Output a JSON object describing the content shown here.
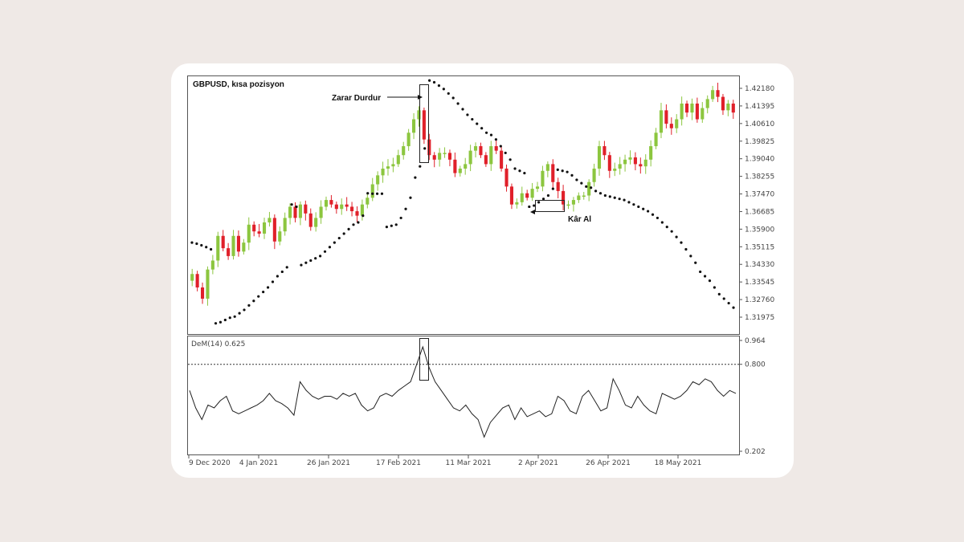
{
  "chart_data": [
    {
      "type": "candlestick",
      "title": "GBPUSD, kısa pozisyon",
      "x_tick_labels": [
        "9 Dec 2020",
        "4 Jan 2021",
        "26 Jan 2021",
        "17 Feb 2021",
        "11 Mar 2021",
        "2 Apr 2021",
        "26 Apr 2021",
        "18 May 2021"
      ],
      "y_tick_labels": [
        "1.42180",
        "1.41395",
        "1.40610",
        "1.39825",
        "1.39040",
        "1.38255",
        "1.37470",
        "1.36685",
        "1.35900",
        "1.35115",
        "1.34330",
        "1.33545",
        "1.32760",
        "1.31975"
      ],
      "ylim": [
        1.3163,
        1.4253
      ],
      "colors": {
        "up": "#8cc63f",
        "down": "#e0202a",
        "sar": "#111111"
      },
      "annotations": {
        "stop_loss": "Zarar Durdur",
        "take_profit": "Kâr Al"
      },
      "close": [
        1.339,
        1.333,
        1.328,
        1.341,
        1.345,
        1.356,
        1.3505,
        1.347,
        1.356,
        1.349,
        1.353,
        1.361,
        1.358,
        1.357,
        1.362,
        1.364,
        1.3535,
        1.358,
        1.364,
        1.369,
        1.364,
        1.37,
        1.366,
        1.36,
        1.364,
        1.369,
        1.372,
        1.37,
        1.368,
        1.37,
        1.369,
        1.367,
        1.365,
        1.37,
        1.373,
        1.379,
        1.383,
        1.386,
        1.387,
        1.388,
        1.392,
        1.396,
        1.402,
        1.408,
        1.412,
        1.399,
        1.392,
        1.39,
        1.393,
        1.393,
        1.39,
        1.384,
        1.386,
        1.388,
        1.394,
        1.396,
        1.392,
        1.388,
        1.396,
        1.394,
        1.386,
        1.378,
        1.37,
        1.371,
        1.375,
        1.373,
        1.377,
        1.378,
        1.385,
        1.388,
        1.38,
        1.376,
        1.37,
        1.37,
        1.372,
        1.374,
        1.374,
        1.38,
        1.386,
        1.396,
        1.392,
        1.385,
        1.386,
        1.388,
        1.39,
        1.391,
        1.388,
        1.387,
        1.39,
        1.396,
        1.402,
        1.412,
        1.406,
        1.404,
        1.408,
        1.415,
        1.411,
        1.415,
        1.408,
        1.413,
        1.417,
        1.421,
        1.418,
        1.412,
        1.415,
        1.411
      ],
      "sar_y": [
        1.353,
        1.3525,
        1.3518,
        1.351,
        1.35,
        1.317,
        1.3175,
        1.3185,
        1.3195,
        1.32,
        1.3215,
        1.323,
        1.325,
        1.327,
        1.329,
        1.331,
        1.333,
        1.3355,
        1.338,
        1.34,
        1.342,
        1.37,
        1.369,
        1.343,
        1.344,
        1.345,
        1.346,
        1.347,
        1.349,
        1.351,
        1.353,
        1.355,
        1.357,
        1.359,
        1.361,
        1.362,
        1.365,
        1.375,
        1.3748,
        1.3748,
        1.3748,
        1.36,
        1.3605,
        1.361,
        1.364,
        1.368,
        1.373,
        1.382,
        1.387,
        1.395,
        1.4253,
        1.4245,
        1.423,
        1.4215,
        1.4195,
        1.4175,
        1.415,
        1.4125,
        1.41,
        1.408,
        1.406,
        1.404,
        1.402,
        1.401,
        1.399,
        1.396,
        1.393,
        1.39,
        1.386,
        1.385,
        1.384,
        1.369,
        1.3695,
        1.371,
        1.3725,
        1.374,
        1.377,
        1.3855,
        1.385,
        1.3845,
        1.383,
        1.381,
        1.3795,
        1.378,
        1.3775,
        1.376,
        1.375,
        1.374,
        1.3735,
        1.373,
        1.3725,
        1.372,
        1.371,
        1.37,
        1.369,
        1.368,
        1.367,
        1.3655,
        1.364,
        1.362,
        1.36,
        1.358,
        1.3555,
        1.353,
        1.35,
        1.347,
        1.344,
        1.34,
        1.338,
        1.336,
        1.333,
        1.33,
        1.328,
        1.326,
        1.324
      ],
      "sar_pairs": [
        [
          0,
          1.353
        ],
        [
          1,
          1.3525
        ],
        [
          2,
          1.3518
        ],
        [
          3,
          1.351
        ],
        [
          4,
          1.35
        ],
        [
          5,
          1.317
        ],
        [
          6,
          1.3175
        ],
        [
          7,
          1.3185
        ],
        [
          8,
          1.3195
        ],
        [
          9,
          1.32
        ],
        [
          10,
          1.3215
        ],
        [
          11,
          1.323
        ],
        [
          12,
          1.325
        ],
        [
          13,
          1.327
        ],
        [
          14,
          1.329
        ],
        [
          15,
          1.331
        ],
        [
          16,
          1.333
        ],
        [
          17,
          1.3355
        ],
        [
          18,
          1.338
        ],
        [
          19,
          1.34
        ],
        [
          20,
          1.342
        ],
        [
          21,
          1.37
        ],
        [
          22,
          1.369
        ],
        [
          23,
          1.343
        ],
        [
          24,
          1.344
        ],
        [
          25,
          1.345
        ],
        [
          26,
          1.346
        ],
        [
          27,
          1.347
        ],
        [
          28,
          1.349
        ],
        [
          29,
          1.351
        ],
        [
          30,
          1.353
        ],
        [
          31,
          1.355
        ],
        [
          32,
          1.357
        ],
        [
          33,
          1.359
        ],
        [
          34,
          1.361
        ],
        [
          35,
          1.362
        ],
        [
          36,
          1.365
        ],
        [
          37,
          1.375
        ],
        [
          38,
          1.3748
        ],
        [
          39,
          1.3748
        ],
        [
          40,
          1.3748
        ],
        [
          41,
          1.36
        ],
        [
          42,
          1.3605
        ],
        [
          43,
          1.361
        ],
        [
          44,
          1.364
        ],
        [
          45,
          1.368
        ],
        [
          46,
          1.373
        ],
        [
          47,
          1.382
        ],
        [
          48,
          1.387
        ],
        [
          49,
          1.395
        ],
        [
          50,
          1.4253
        ],
        [
          51,
          1.4245
        ],
        [
          52,
          1.423
        ],
        [
          53,
          1.4215
        ],
        [
          54,
          1.4195
        ],
        [
          55,
          1.4175
        ],
        [
          56,
          1.415
        ],
        [
          57,
          1.4125
        ],
        [
          58,
          1.41
        ],
        [
          59,
          1.408
        ],
        [
          60,
          1.406
        ],
        [
          61,
          1.404
        ],
        [
          62,
          1.402
        ],
        [
          63,
          1.401
        ],
        [
          64,
          1.399
        ],
        [
          65,
          1.396
        ],
        [
          66,
          1.393
        ],
        [
          67,
          1.39
        ],
        [
          68,
          1.386
        ],
        [
          69,
          1.385
        ],
        [
          70,
          1.384
        ],
        [
          71,
          1.369
        ],
        [
          72,
          1.3695
        ],
        [
          73,
          1.371
        ],
        [
          74,
          1.3725
        ],
        [
          75,
          1.374
        ],
        [
          76,
          1.377
        ],
        [
          77,
          1.3855
        ],
        [
          78,
          1.385
        ],
        [
          79,
          1.3845
        ],
        [
          80,
          1.383
        ],
        [
          81,
          1.381
        ],
        [
          82,
          1.3795
        ],
        [
          83,
          1.378
        ],
        [
          84,
          1.3775
        ],
        [
          85,
          1.376
        ],
        [
          86,
          1.375
        ],
        [
          87,
          1.374
        ],
        [
          88,
          1.3735
        ],
        [
          89,
          1.373
        ],
        [
          90,
          1.3725
        ],
        [
          91,
          1.372
        ],
        [
          92,
          1.371
        ],
        [
          93,
          1.37
        ],
        [
          94,
          1.369
        ],
        [
          95,
          1.368
        ],
        [
          96,
          1.367
        ],
        [
          97,
          1.3655
        ],
        [
          98,
          1.364
        ],
        [
          99,
          1.362
        ],
        [
          100,
          1.36
        ],
        [
          101,
          1.358
        ],
        [
          102,
          1.3555
        ],
        [
          103,
          1.353
        ],
        [
          104,
          1.35
        ],
        [
          105,
          1.347
        ],
        [
          106,
          1.344
        ],
        [
          107,
          1.34
        ],
        [
          108,
          1.338
        ],
        [
          109,
          1.336
        ],
        [
          110,
          1.333
        ],
        [
          111,
          1.33
        ],
        [
          112,
          1.328
        ],
        [
          113,
          1.326
        ],
        [
          114,
          1.324
        ]
      ]
    },
    {
      "type": "line",
      "label": "DeM(14) 0.625",
      "y_tick_labels": [
        "0.964",
        "0.800",
        "0.202"
      ],
      "ylim": [
        0.202,
        0.964
      ],
      "level": 0.8,
      "values": [
        0.62,
        0.5,
        0.42,
        0.52,
        0.5,
        0.55,
        0.58,
        0.48,
        0.46,
        0.48,
        0.5,
        0.52,
        0.55,
        0.6,
        0.55,
        0.53,
        0.5,
        0.45,
        0.68,
        0.62,
        0.58,
        0.56,
        0.58,
        0.58,
        0.56,
        0.6,
        0.58,
        0.6,
        0.52,
        0.48,
        0.5,
        0.58,
        0.6,
        0.58,
        0.62,
        0.65,
        0.68,
        0.8,
        0.92,
        0.78,
        0.68,
        0.62,
        0.56,
        0.5,
        0.48,
        0.52,
        0.46,
        0.42,
        0.3,
        0.4,
        0.45,
        0.5,
        0.52,
        0.42,
        0.5,
        0.44,
        0.46,
        0.48,
        0.44,
        0.46,
        0.58,
        0.55,
        0.48,
        0.46,
        0.58,
        0.62,
        0.55,
        0.48,
        0.5,
        0.7,
        0.62,
        0.52,
        0.5,
        0.58,
        0.52,
        0.48,
        0.46,
        0.6,
        0.58,
        0.56,
        0.58,
        0.62,
        0.68,
        0.66,
        0.7,
        0.68,
        0.62,
        0.58,
        0.62,
        0.6
      ]
    }
  ]
}
